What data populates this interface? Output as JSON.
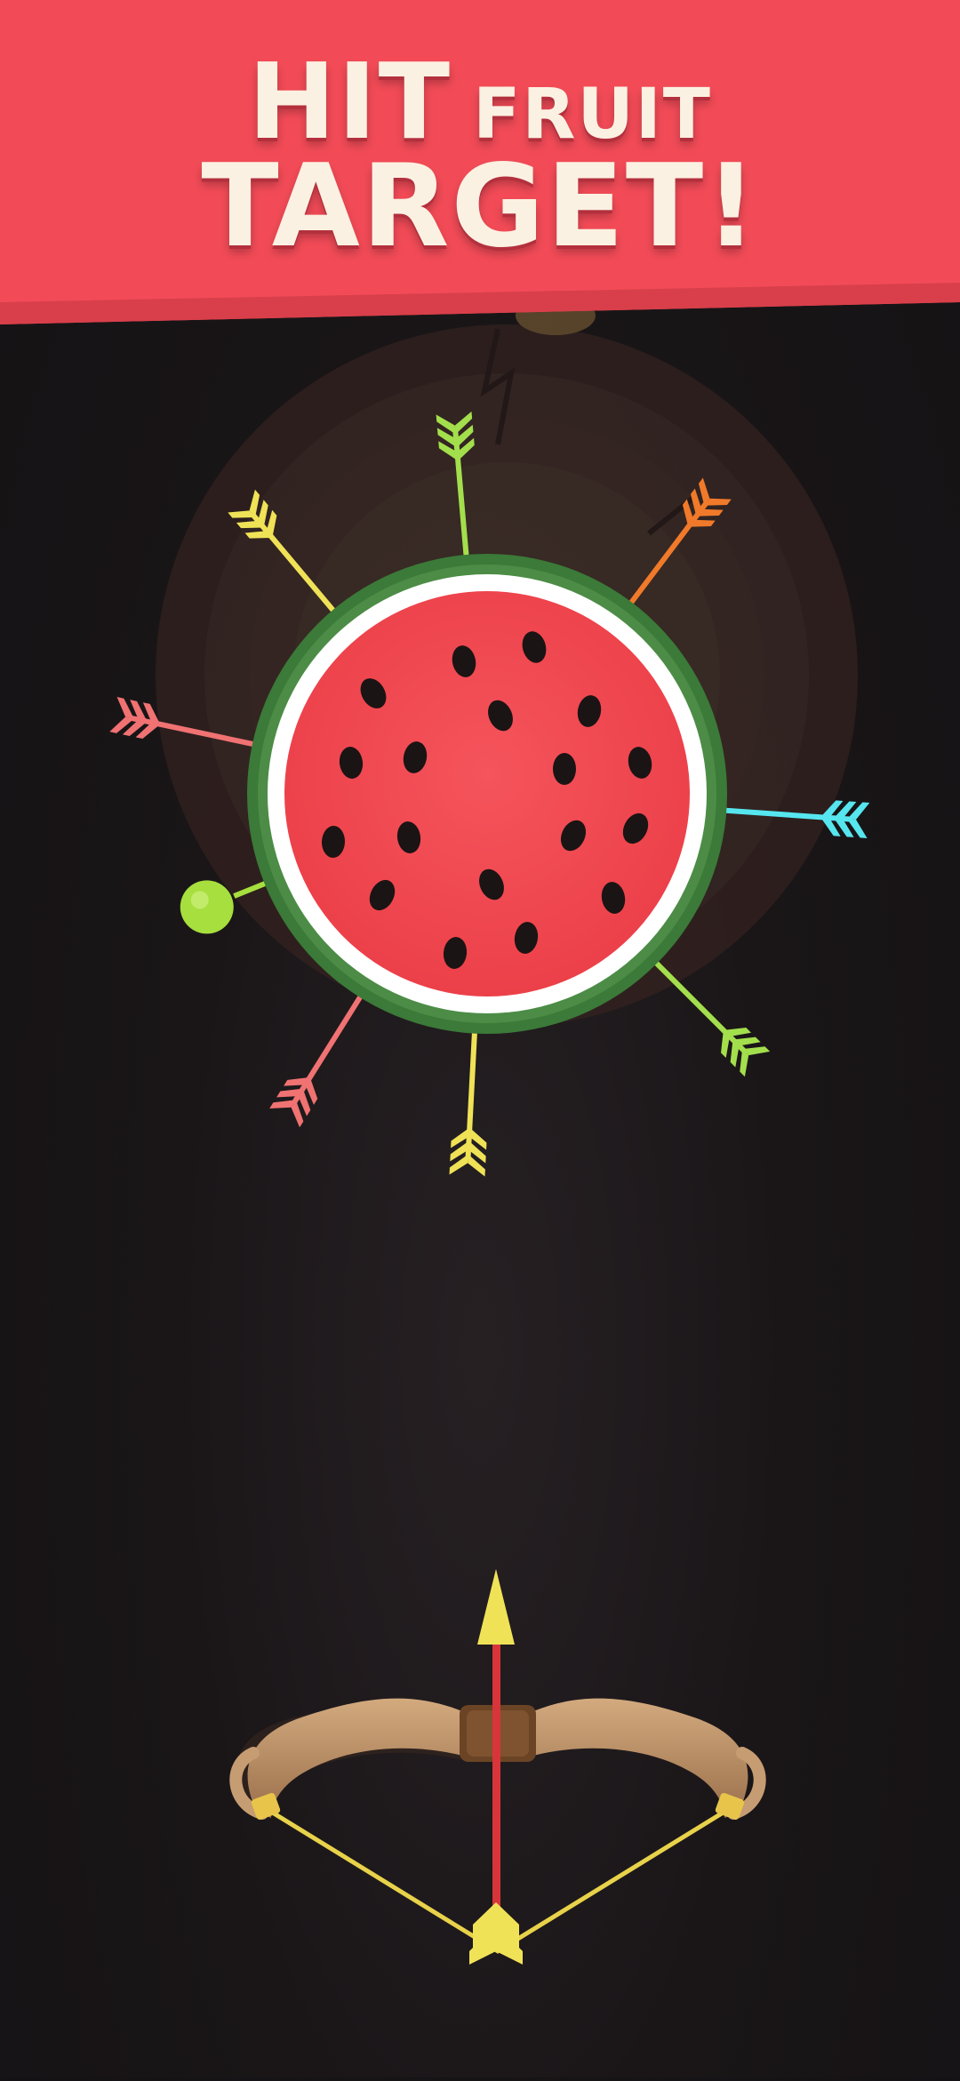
{
  "banner": {
    "line1_big": "HIT",
    "line1_small": "FRUIT",
    "line2": "TARGET!",
    "color": "#f24b57"
  },
  "target": {
    "fruit": "watermelon",
    "flesh_color": "#f2474f",
    "rind_color": "#3d7d3a",
    "board": "wooden-log"
  },
  "stuck_arrows": [
    {
      "color": "#f0e257",
      "angle_deg": -130
    },
    {
      "color": "#a3df4c",
      "angle_deg": -95
    },
    {
      "color": "#f07a2a",
      "angle_deg": -53
    },
    {
      "color": "#f07272",
      "angle_deg": -168
    },
    {
      "color": "#56e6ef",
      "angle_deg": 4
    },
    {
      "color": "#a3df4c",
      "angle_deg": 45
    },
    {
      "color": "#f0e257",
      "angle_deg": 93
    },
    {
      "color": "#f07272",
      "angle_deg": 122
    }
  ],
  "bonus_apple": {
    "color": "#a6df3e",
    "angle_deg": 158
  },
  "bow": {
    "arrow_color": "#f0e257",
    "shaft_color": "#d8353a"
  }
}
